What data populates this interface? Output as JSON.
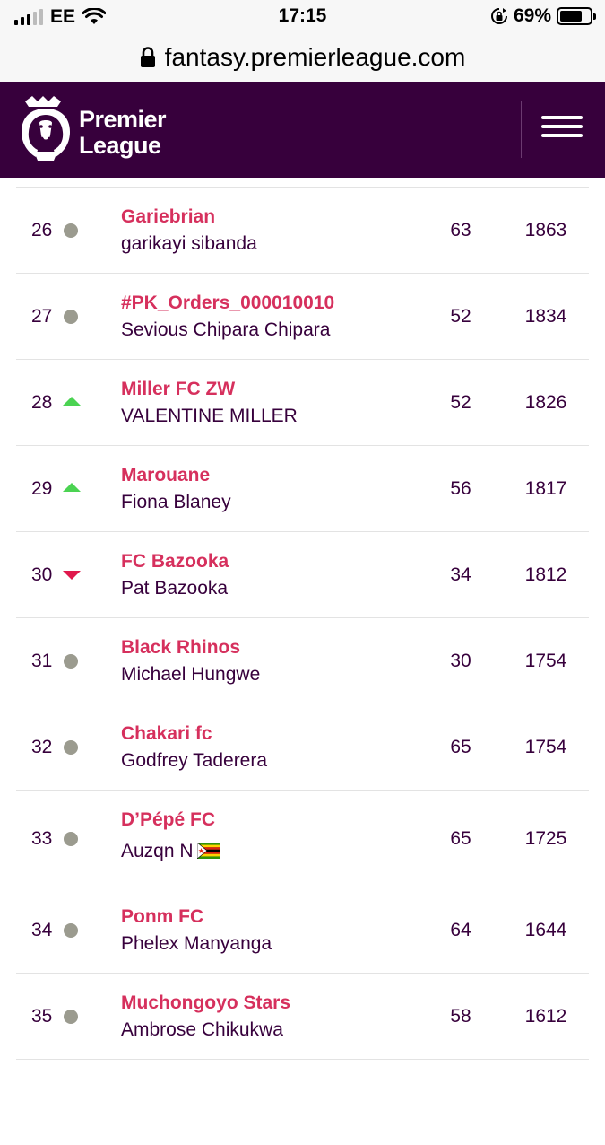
{
  "status_bar": {
    "carrier": "EE",
    "time": "17:15",
    "battery_pct": "69%",
    "icons": [
      "signal-icon",
      "wifi-icon",
      "rotation-lock-icon",
      "battery-icon"
    ]
  },
  "browser": {
    "url": "fantasy.premierleague.com",
    "icons": [
      "lock-icon"
    ]
  },
  "header": {
    "brand_line1": "Premier",
    "brand_line2": "League",
    "colors": {
      "background": "#37003c",
      "accent": "#e90052"
    },
    "icons": [
      "premier-league-lion-logo",
      "hamburger-menu-icon"
    ]
  },
  "standings": {
    "rows": [
      {
        "rank": "26",
        "movement": "same",
        "team": "Gariebrian",
        "manager": "garikayi sibanda",
        "gw": "63",
        "total": "1863"
      },
      {
        "rank": "27",
        "movement": "same",
        "team": "#PK_Orders_000010010",
        "manager": "Sevious Chipara Chipara",
        "gw": "52",
        "total": "1834"
      },
      {
        "rank": "28",
        "movement": "up",
        "team": "Miller FC ZW",
        "manager": "VALENTINE MILLER",
        "gw": "52",
        "total": "1826"
      },
      {
        "rank": "29",
        "movement": "up",
        "team": "Marouane",
        "manager": "Fiona Blaney",
        "gw": "56",
        "total": "1817"
      },
      {
        "rank": "30",
        "movement": "down",
        "team": "FC Bazooka",
        "manager": "Pat Bazooka",
        "gw": "34",
        "total": "1812"
      },
      {
        "rank": "31",
        "movement": "same",
        "team": "Black Rhinos",
        "manager": "Michael Hungwe",
        "gw": "30",
        "total": "1754"
      },
      {
        "rank": "32",
        "movement": "same",
        "team": "Chakari fc",
        "manager": "Godfrey Taderera",
        "gw": "65",
        "total": "1754"
      },
      {
        "rank": "33",
        "movement": "same",
        "team": "D’Pépé FC",
        "manager": "Auzqn N",
        "manager_flag": "zimbabwe-flag-icon",
        "gw": "65",
        "total": "1725"
      },
      {
        "rank": "34",
        "movement": "same",
        "team": "Ponm FC",
        "manager": "Phelex Manyanga",
        "gw": "64",
        "total": "1644"
      },
      {
        "rank": "35",
        "movement": "same",
        "team": "Muchongoyo Stars",
        "manager": "Ambrose Chikukwa",
        "gw": "58",
        "total": "1612"
      }
    ],
    "colors": {
      "team_name": "#d6305d",
      "up": "#4bd352",
      "down": "#e0194d",
      "same": "#9b9b8f"
    }
  }
}
